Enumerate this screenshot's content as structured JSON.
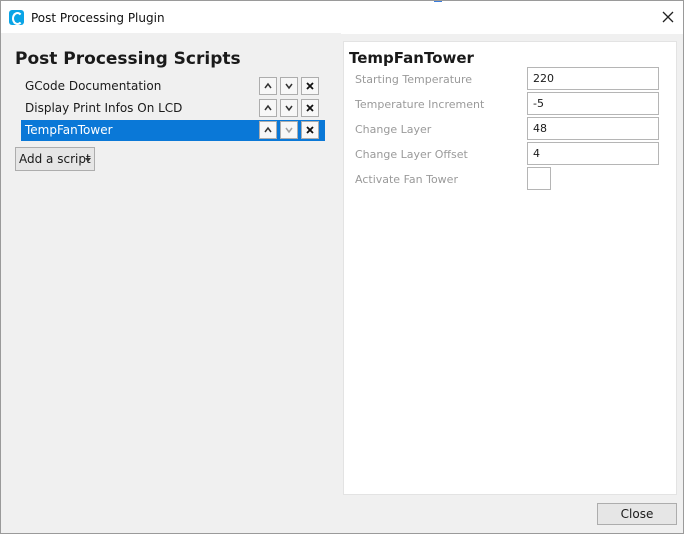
{
  "window": {
    "title": "Post Processing Plugin",
    "icon": "cura-c-icon",
    "close_icon": "close-icon"
  },
  "scripts_panel": {
    "heading": "Post Processing Scripts",
    "items": [
      {
        "label": "GCode Documentation",
        "selected": false
      },
      {
        "label": "Display Print Infos On LCD",
        "selected": false
      },
      {
        "label": "TempFanTower",
        "selected": true
      }
    ],
    "add_button": "Add a script"
  },
  "settings_panel": {
    "title": "TempFanTower",
    "fields": [
      {
        "label": "Starting Temperature",
        "value": "220",
        "type": "text"
      },
      {
        "label": "Temperature Increment",
        "value": "-5",
        "type": "text"
      },
      {
        "label": "Change Layer",
        "value": "48",
        "type": "text"
      },
      {
        "label": "Change Layer Offset",
        "value": "4",
        "type": "text"
      },
      {
        "label": "Activate Fan Tower",
        "value": "",
        "type": "checkbox",
        "checked": false
      }
    ]
  },
  "footer": {
    "close_button": "Close"
  },
  "colors": {
    "selection": "#0a78d7",
    "accent": "#0aa4e6"
  }
}
